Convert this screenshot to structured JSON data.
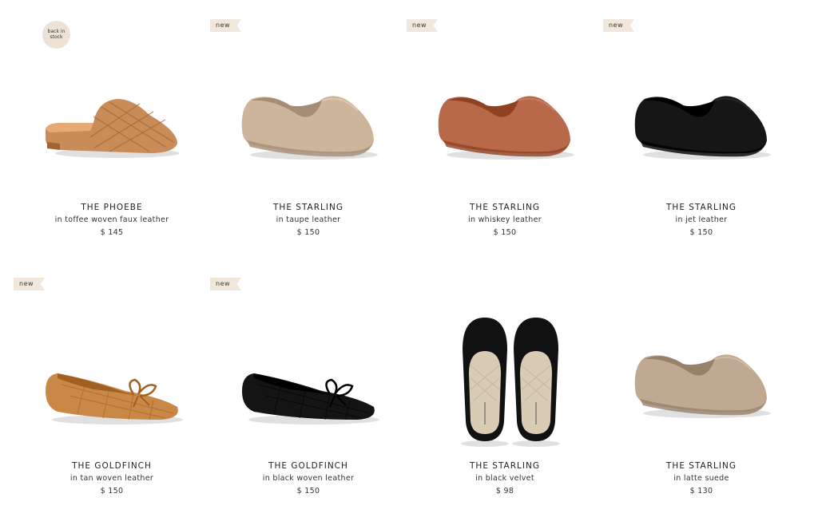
{
  "products": [
    {
      "badge": "back in stock",
      "badge_type": "circle",
      "name": "THE PHOEBE",
      "variant": "in toffee woven faux leather",
      "price": "$ 145",
      "color": "#c98b57",
      "shape": "mule"
    },
    {
      "badge": "new",
      "badge_type": "flag",
      "name": "THE STARLING",
      "variant": "in taupe leather",
      "price": "$ 150",
      "color": "#cdb59c",
      "shape": "loafer"
    },
    {
      "badge": "new",
      "badge_type": "flag",
      "name": "THE STARLING",
      "variant": "in whiskey leather",
      "price": "$ 150",
      "color": "#b8694a",
      "shape": "loafer"
    },
    {
      "badge": "new",
      "badge_type": "flag",
      "name": "THE STARLING",
      "variant": "in jet leather",
      "price": "$ 150",
      "color": "#161616",
      "shape": "loafer"
    },
    {
      "badge": "new",
      "badge_type": "flag",
      "name": "THE GOLDFINCH",
      "variant": "in tan woven leather",
      "price": "$ 150",
      "color": "#c98848",
      "shape": "ballet"
    },
    {
      "badge": "new",
      "badge_type": "flag",
      "name": "THE GOLDFINCH",
      "variant": "in black woven leather",
      "price": "$ 150",
      "color": "#141414",
      "shape": "ballet"
    },
    {
      "badge": "",
      "badge_type": "none",
      "name": "THE STARLING",
      "variant": "in black velvet",
      "price": "$ 98",
      "color": "#111111",
      "shape": "pair-top"
    },
    {
      "badge": "",
      "badge_type": "none",
      "name": "THE STARLING",
      "variant": "in latte suede",
      "price": "$ 130",
      "color": "#bfa993",
      "shape": "loafer"
    }
  ]
}
